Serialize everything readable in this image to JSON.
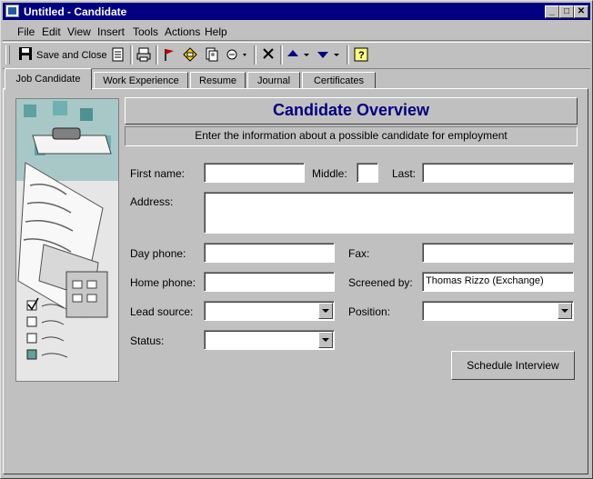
{
  "window": {
    "title": "Untitled - Candidate"
  },
  "menu": [
    "File",
    "Edit",
    "View",
    "Insert",
    "Tools",
    "Actions",
    "Help"
  ],
  "toolbar": {
    "save_close_label": "Save and Close"
  },
  "tabs": [
    "Job Candidate",
    "Work Experience",
    "Resume",
    "Journal",
    "Certificates"
  ],
  "form": {
    "title": "Candidate Overview",
    "subtitle": "Enter the information about a possible candidate for employment",
    "labels": {
      "first_name": "First name:",
      "middle": "Middle:",
      "last": "Last:",
      "address": "Address:",
      "day_phone": "Day phone:",
      "fax": "Fax:",
      "home_phone": "Home phone:",
      "screened_by": "Screened by:",
      "lead_source": "Lead source:",
      "position": "Position:",
      "status": "Status:"
    },
    "values": {
      "first_name": "",
      "middle": "",
      "last": "",
      "address": "",
      "day_phone": "",
      "fax": "",
      "home_phone": "",
      "screened_by": "Thomas Rizzo (Exchange)",
      "lead_source": "",
      "position": "",
      "status": ""
    },
    "schedule_button": "Schedule Interview"
  }
}
